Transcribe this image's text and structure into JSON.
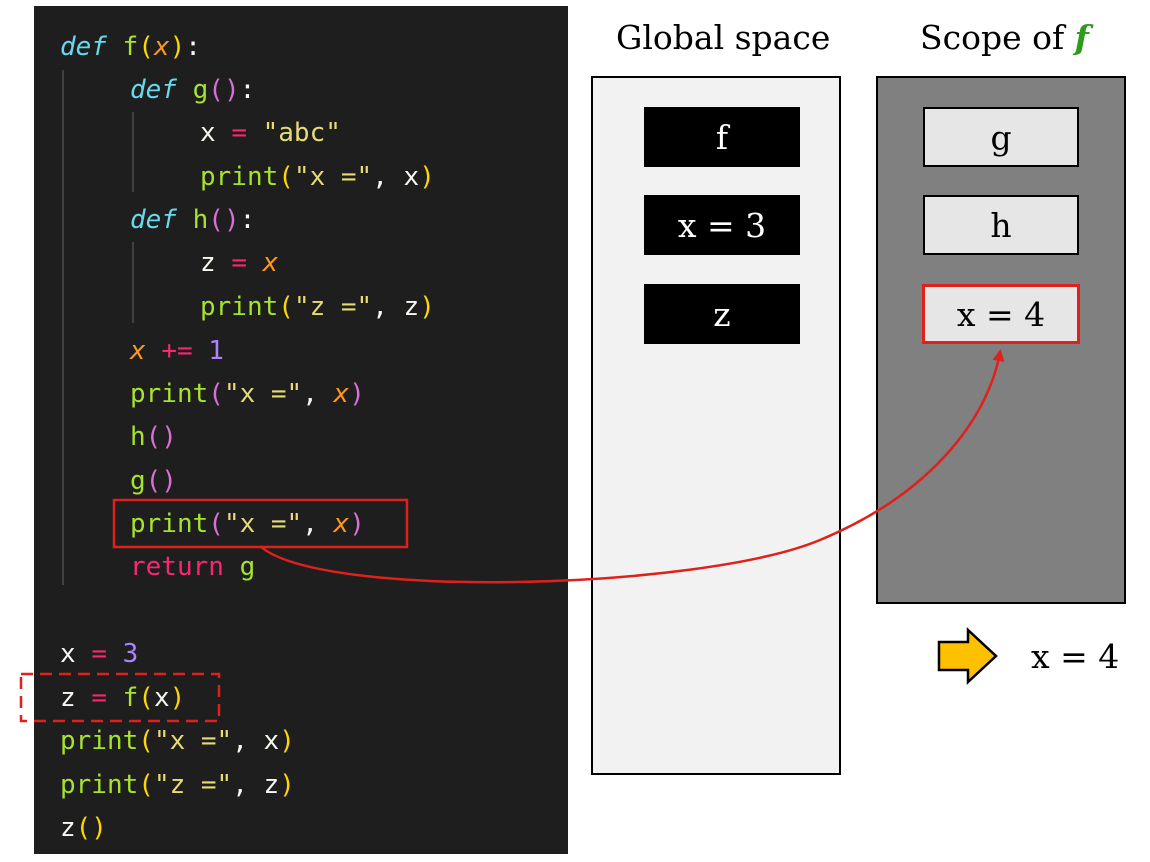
{
  "code": {
    "lines": [
      [
        {
          "t": "def",
          "c": "kw-def"
        },
        {
          "t": " "
        },
        {
          "t": "f",
          "c": "fn"
        },
        {
          "t": "(",
          "c": "p1"
        },
        {
          "t": "x",
          "c": "param"
        },
        {
          "t": ")",
          "c": "p1"
        },
        {
          "t": ":",
          "c": "plain"
        }
      ],
      [
        {
          "t": "def",
          "c": "kw-def"
        },
        {
          "t": " "
        },
        {
          "t": "g",
          "c": "fn"
        },
        {
          "t": "(",
          "c": "p2"
        },
        {
          "t": ")",
          "c": "p2"
        },
        {
          "t": ":",
          "c": "plain"
        }
      ],
      [
        {
          "t": "x",
          "c": "plain"
        },
        {
          "t": " "
        },
        {
          "t": "=",
          "c": "op"
        },
        {
          "t": " "
        },
        {
          "t": "\"abc\"",
          "c": "str"
        }
      ],
      [
        {
          "t": "print",
          "c": "fn"
        },
        {
          "t": "(",
          "c": "p1"
        },
        {
          "t": "\"x =\"",
          "c": "str"
        },
        {
          "t": ", ",
          "c": "plain"
        },
        {
          "t": "x",
          "c": "plain"
        },
        {
          "t": ")",
          "c": "p1"
        }
      ],
      [
        {
          "t": "def",
          "c": "kw-def"
        },
        {
          "t": " "
        },
        {
          "t": "h",
          "c": "fn"
        },
        {
          "t": "(",
          "c": "p2"
        },
        {
          "t": ")",
          "c": "p2"
        },
        {
          "t": ":",
          "c": "plain"
        }
      ],
      [
        {
          "t": "z",
          "c": "plain"
        },
        {
          "t": " "
        },
        {
          "t": "=",
          "c": "op"
        },
        {
          "t": " "
        },
        {
          "t": "x",
          "c": "param"
        }
      ],
      [
        {
          "t": "print",
          "c": "fn"
        },
        {
          "t": "(",
          "c": "p1"
        },
        {
          "t": "\"z =\"",
          "c": "str"
        },
        {
          "t": ", ",
          "c": "plain"
        },
        {
          "t": "z",
          "c": "plain"
        },
        {
          "t": ")",
          "c": "p1"
        }
      ],
      [
        {
          "t": "x",
          "c": "param"
        },
        {
          "t": " "
        },
        {
          "t": "+=",
          "c": "op"
        },
        {
          "t": " "
        },
        {
          "t": "1",
          "c": "num"
        }
      ],
      [
        {
          "t": "print",
          "c": "fn"
        },
        {
          "t": "(",
          "c": "p2"
        },
        {
          "t": "\"x =\"",
          "c": "str"
        },
        {
          "t": ", ",
          "c": "plain"
        },
        {
          "t": "x",
          "c": "param"
        },
        {
          "t": ")",
          "c": "p2"
        }
      ],
      [
        {
          "t": "h",
          "c": "fn"
        },
        {
          "t": "()",
          "c": "p2"
        }
      ],
      [
        {
          "t": "g",
          "c": "fn"
        },
        {
          "t": "()",
          "c": "p2"
        }
      ],
      [
        {
          "t": "print",
          "c": "fn"
        },
        {
          "t": "(",
          "c": "p2"
        },
        {
          "t": "\"x =\"",
          "c": "str"
        },
        {
          "t": ", ",
          "c": "plain"
        },
        {
          "t": "x",
          "c": "param"
        },
        {
          "t": ")",
          "c": "p2"
        }
      ],
      [
        {
          "t": "return",
          "c": "kw-ret"
        },
        {
          "t": " "
        },
        {
          "t": "g",
          "c": "fn"
        }
      ],
      [],
      [
        {
          "t": "x",
          "c": "plain"
        },
        {
          "t": " "
        },
        {
          "t": "=",
          "c": "op"
        },
        {
          "t": " "
        },
        {
          "t": "3",
          "c": "num"
        }
      ],
      [
        {
          "t": "z",
          "c": "plain"
        },
        {
          "t": " "
        },
        {
          "t": "=",
          "c": "op"
        },
        {
          "t": " "
        },
        {
          "t": "f",
          "c": "fn"
        },
        {
          "t": "(",
          "c": "p1"
        },
        {
          "t": "x",
          "c": "plain"
        },
        {
          "t": ")",
          "c": "p1"
        }
      ],
      [
        {
          "t": "print",
          "c": "fn"
        },
        {
          "t": "(",
          "c": "p1"
        },
        {
          "t": "\"x =\"",
          "c": "str"
        },
        {
          "t": ", ",
          "c": "plain"
        },
        {
          "t": "x",
          "c": "plain"
        },
        {
          "t": ")",
          "c": "p1"
        }
      ],
      [
        {
          "t": "print",
          "c": "fn"
        },
        {
          "t": "(",
          "c": "p1"
        },
        {
          "t": "\"z =\"",
          "c": "str"
        },
        {
          "t": ", ",
          "c": "plain"
        },
        {
          "t": "z",
          "c": "plain"
        },
        {
          "t": ")",
          "c": "p1"
        }
      ],
      [
        {
          "t": "z",
          "c": "plain"
        },
        {
          "t": "()",
          "c": "p1"
        }
      ]
    ]
  },
  "global_scope": {
    "title": "Global space",
    "items": [
      "f",
      "x = 3",
      "z"
    ]
  },
  "f_scope": {
    "title_prefix": "Scope of ",
    "title_name": "f",
    "items": [
      "g",
      "h",
      "x = 4"
    ],
    "highlighted_item": "x = 4"
  },
  "result": {
    "text": "x = 4",
    "icon": "right-arrow-icon"
  },
  "colors": {
    "editor_bg": "#1e1e1e",
    "highlight_red": "#e0201b",
    "global_panel_bg": "#f2f2f2",
    "f_panel_bg": "#808080",
    "arrow_orange": "#ffc000",
    "scope_name_green": "#2e9b1e"
  }
}
